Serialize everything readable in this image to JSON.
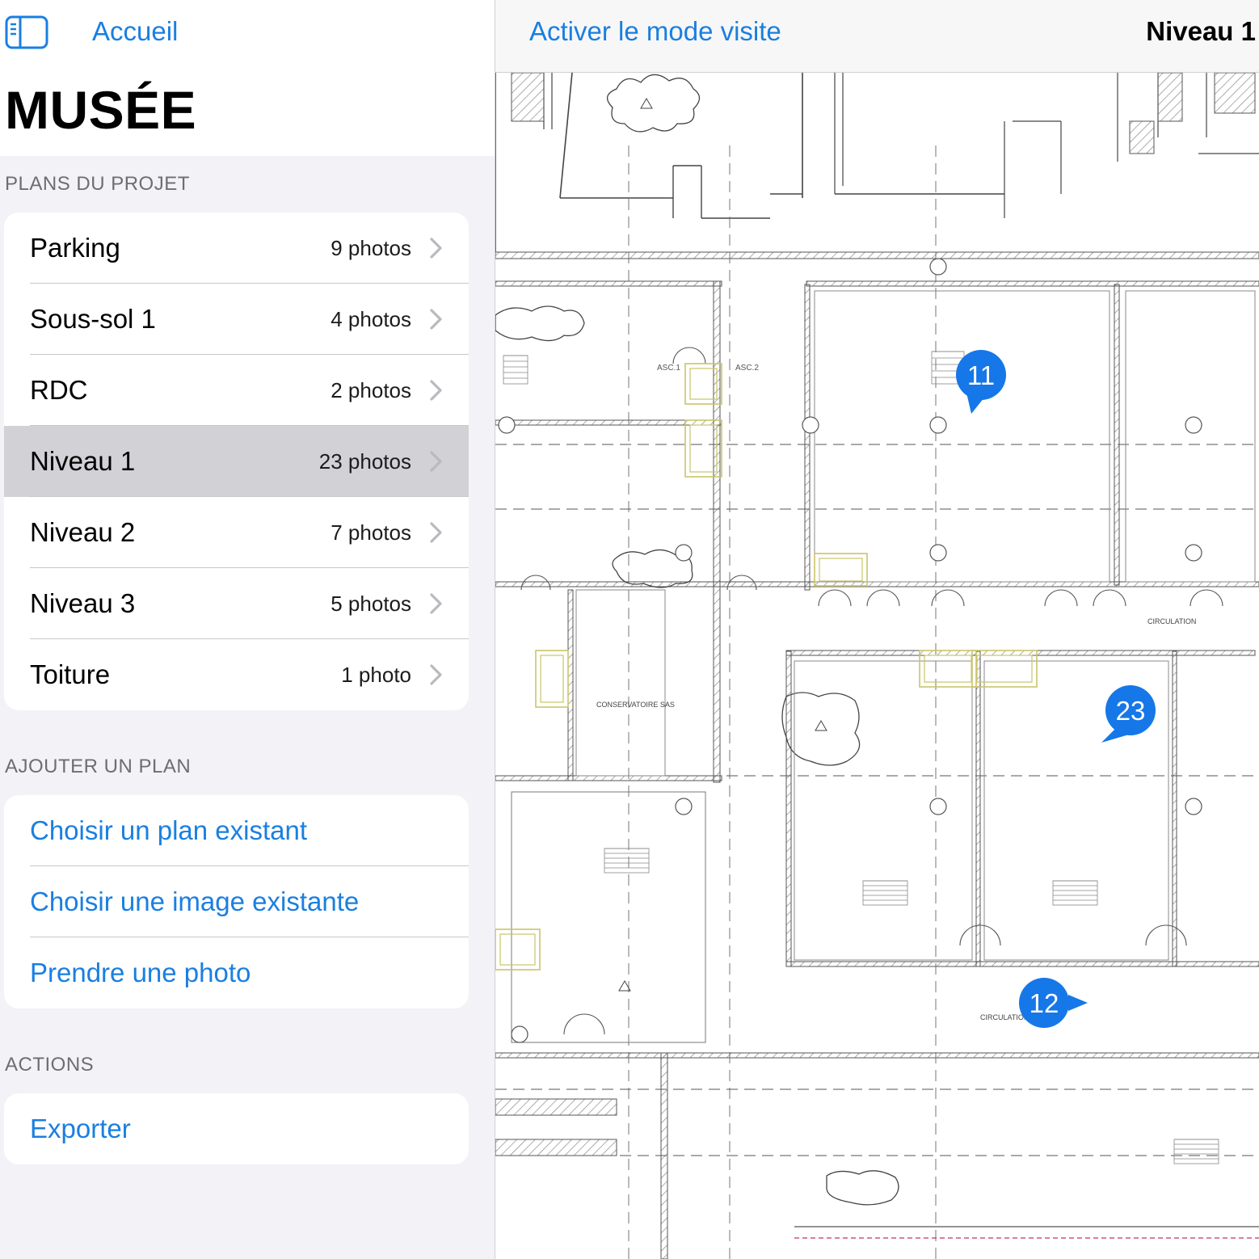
{
  "sidebar": {
    "back_label": "Accueil",
    "title": "MUSÉE",
    "sections": {
      "plans_header": "PLANS DU PROJET",
      "add_header": "AJOUTER UN PLAN",
      "actions_header": "ACTIONS"
    },
    "plans": [
      {
        "name": "Parking",
        "count": "9 photos",
        "selected": false
      },
      {
        "name": "Sous-sol 1",
        "count": "4 photos",
        "selected": false
      },
      {
        "name": "RDC",
        "count": "2 photos",
        "selected": false
      },
      {
        "name": "Niveau 1",
        "count": "23 photos",
        "selected": true
      },
      {
        "name": "Niveau 2",
        "count": "7 photos",
        "selected": false
      },
      {
        "name": "Niveau 3",
        "count": "5 photos",
        "selected": false
      },
      {
        "name": "Toiture",
        "count": "1 photo",
        "selected": false
      }
    ],
    "add_options": [
      {
        "label": "Choisir un plan existant"
      },
      {
        "label": "Choisir une image existante"
      },
      {
        "label": "Prendre une photo"
      }
    ],
    "actions": [
      {
        "label": "Exporter"
      }
    ]
  },
  "detail": {
    "visit_mode_label": "Activer le mode visite",
    "plan_title": "Niveau 1",
    "plan_labels": {
      "asc1": "ASC.1",
      "asc2": "ASC.2",
      "conservatoire_sas": "CONSERVATOIRE SAS",
      "circulation_a": "CIRCULATION",
      "circulation_b": "CIRCULATION"
    },
    "pins": [
      {
        "number": "11",
        "direction": "down-left"
      },
      {
        "number": "23",
        "direction": "down-left"
      },
      {
        "number": "12",
        "direction": "right"
      }
    ]
  },
  "colors": {
    "accent": "#1a7fe0",
    "pin": "#1677e8",
    "selected_row": "#d1d1d6",
    "grouped_background": "#f2f2f7"
  }
}
